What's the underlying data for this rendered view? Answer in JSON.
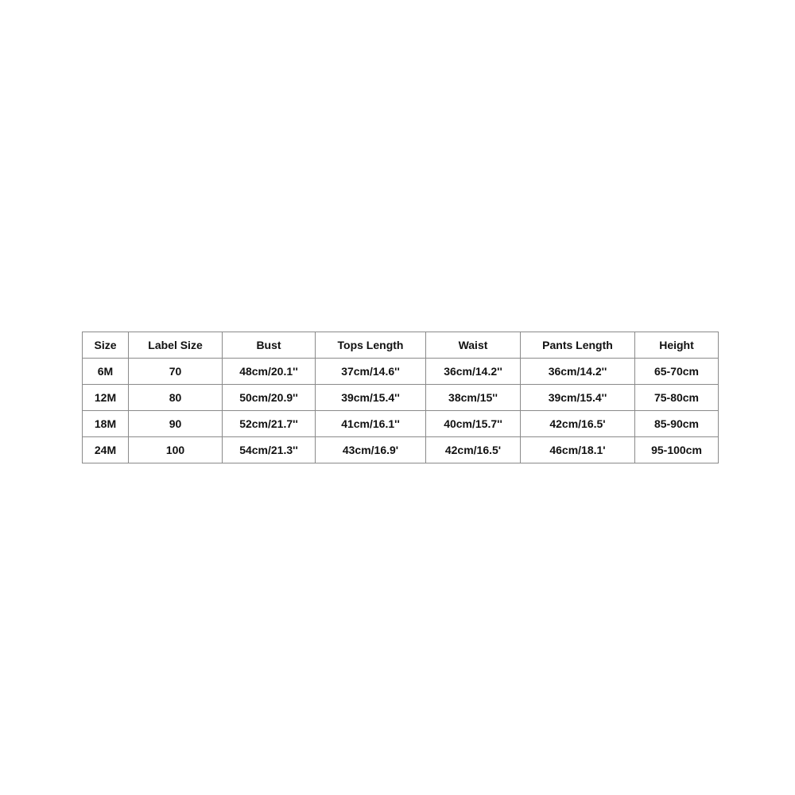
{
  "size_chart": {
    "headers": [
      "Size",
      "Label Size",
      "Bust",
      "Tops Length",
      "Waist",
      "Pants Length",
      "Height"
    ],
    "rows": [
      [
        "6M",
        "70",
        "48cm/20.1''",
        "37cm/14.6''",
        "36cm/14.2''",
        "36cm/14.2''",
        "65-70cm"
      ],
      [
        "12M",
        "80",
        "50cm/20.9''",
        "39cm/15.4''",
        "38cm/15''",
        "39cm/15.4''",
        "75-80cm"
      ],
      [
        "18M",
        "90",
        "52cm/21.7''",
        "41cm/16.1''",
        "40cm/15.7''",
        "42cm/16.5'",
        "85-90cm"
      ],
      [
        "24M",
        "100",
        "54cm/21.3''",
        "43cm/16.9'",
        "42cm/16.5'",
        "46cm/18.1'",
        "95-100cm"
      ]
    ]
  }
}
